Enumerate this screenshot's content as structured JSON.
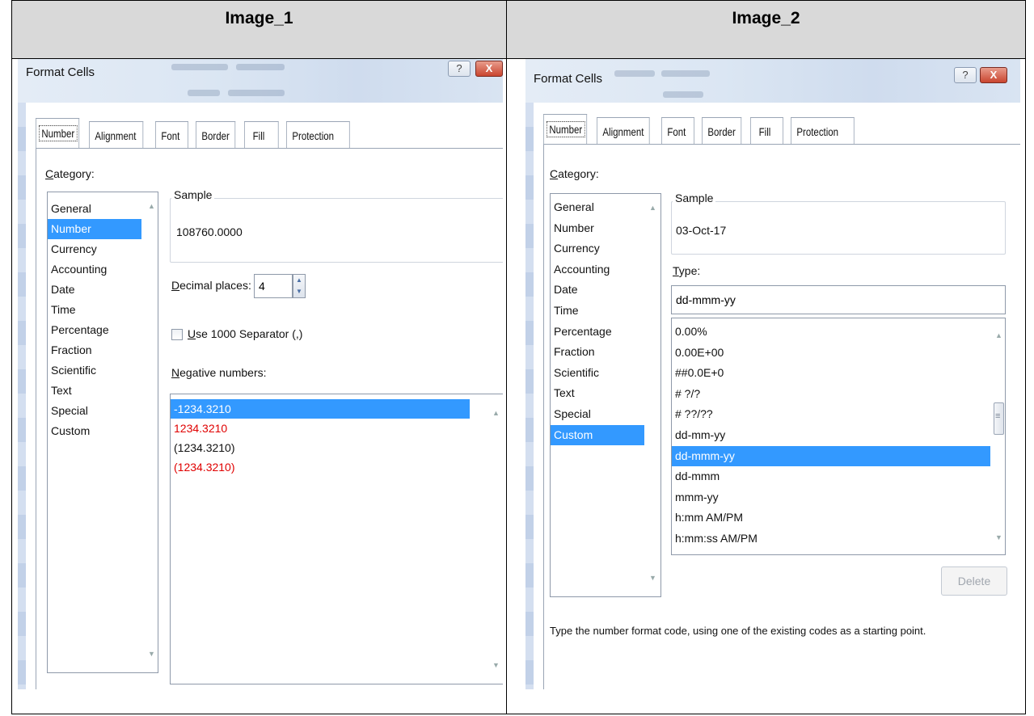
{
  "header": {
    "image1_label": "Image_1",
    "image2_label": "Image_2"
  },
  "dialog": {
    "title": "Format Cells",
    "help_glyph": "?",
    "close_glyph": "X",
    "tabs": [
      "Number",
      "Alignment",
      "Font",
      "Border",
      "Fill",
      "Protection"
    ],
    "active_tab": "Number",
    "category_label_u": "C",
    "category_label_rest": "ategory:",
    "categories": [
      "General",
      "Number",
      "Currency",
      "Accounting",
      "Date",
      "Time",
      "Percentage",
      "Fraction",
      "Scientific",
      "Text",
      "Special",
      "Custom"
    ],
    "sample_label": "Sample"
  },
  "image1": {
    "selected_category": "Number",
    "sample_value": "108760.0000",
    "decimal_label_u": "D",
    "decimal_label_rest": "ecimal places:",
    "decimal_value": "4",
    "separator_label_u": "U",
    "separator_label_rest": "se 1000 Separator (,)",
    "separator_checked": false,
    "negative_label_u": "N",
    "negative_label_rest": "egative numbers:",
    "negative_options": [
      {
        "text": "-1234.3210",
        "color": "black",
        "selected": true
      },
      {
        "text": "1234.3210",
        "color": "red",
        "selected": false
      },
      {
        "text": "(1234.3210)",
        "color": "black",
        "selected": false
      },
      {
        "text": "(1234.3210)",
        "color": "red",
        "selected": false
      }
    ]
  },
  "image2": {
    "selected_category": "Custom",
    "sample_value": "03-Oct-17",
    "type_label_u": "T",
    "type_label_rest": "ype:",
    "type_value": "dd-mmm-yy",
    "format_codes": [
      "0.00%",
      "0.00E+00",
      "##0.0E+0",
      "# ?/?",
      "# ??/??",
      "dd-mm-yy",
      "dd-mmm-yy",
      "dd-mmm",
      "mmm-yy",
      "h:mm AM/PM",
      "h:mm:ss AM/PM"
    ],
    "selected_code": "dd-mmm-yy",
    "delete_label": "Delete",
    "hint": "Type the number format code, using one of the existing codes as a starting point."
  }
}
